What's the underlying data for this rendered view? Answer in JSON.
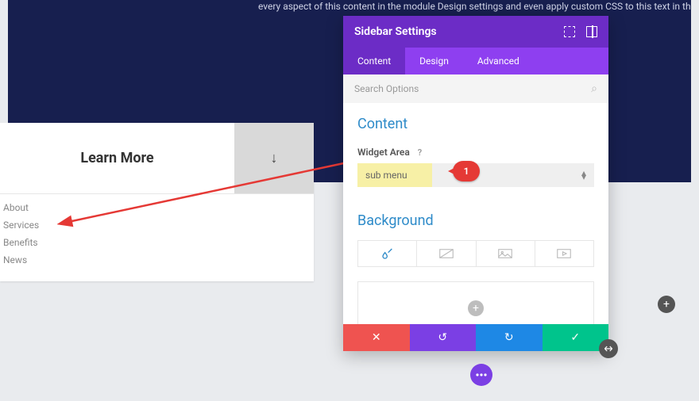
{
  "banner_text": "every aspect of this content in the module Design settings and even apply custom CSS to this text in th",
  "page": {
    "title": "Learn More",
    "arrow_glyph": "↓",
    "menu_items": [
      "About",
      "Services",
      "Benefits",
      "News"
    ]
  },
  "modal": {
    "title": "Sidebar Settings",
    "tabs": [
      "Content",
      "Design",
      "Advanced"
    ],
    "active_tab": 0,
    "search_placeholder": "Search Options",
    "section_content": "Content",
    "widget_label": "Widget Area",
    "widget_help": "?",
    "widget_value": "sub menu",
    "marker_number": "1",
    "section_background": "Background"
  },
  "footer_icons": {
    "cancel": "✕",
    "undo": "↺",
    "redo": "↻",
    "save": "✓"
  },
  "colors": {
    "purple_dark": "#6c2cc6",
    "purple_light": "#8e3ff0",
    "red": "#ef5350",
    "blue": "#1e88e5",
    "green": "#00c48c"
  }
}
